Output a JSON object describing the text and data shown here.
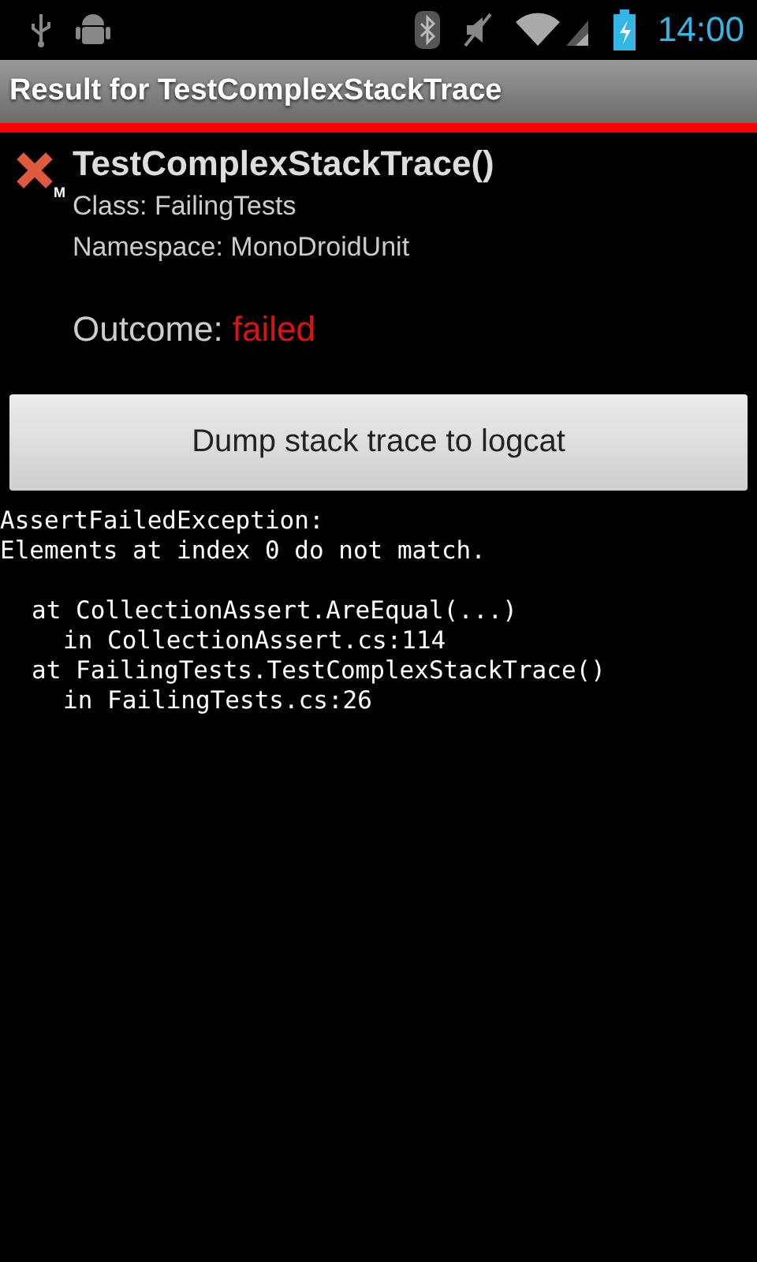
{
  "status_bar": {
    "time": "14:00"
  },
  "title_bar": {
    "title": "Result for TestComplexStackTrace"
  },
  "test": {
    "failed": true,
    "icon_badge": "M",
    "name": "TestComplexStackTrace()",
    "class_line": "Class: FailingTests",
    "namespace_line": "Namespace: MonoDroidUnit",
    "outcome_label": "Outcome:",
    "outcome_value": "failed"
  },
  "dump_button": {
    "label": "Dump stack trace to logcat"
  },
  "stack_trace": {
    "message": [
      "AssertFailedException:",
      "Elements at index 0 do not match."
    ],
    "frames": [
      {
        "text": "at CollectionAssert.AreEqual(...)",
        "children": [
          {
            "text": "in CollectionAssert.cs:114"
          }
        ]
      },
      {
        "text": "at FailingTests.TestComplexStackTrace()",
        "children": [
          {
            "text": "in FailingTests.cs:26"
          }
        ]
      }
    ]
  }
}
